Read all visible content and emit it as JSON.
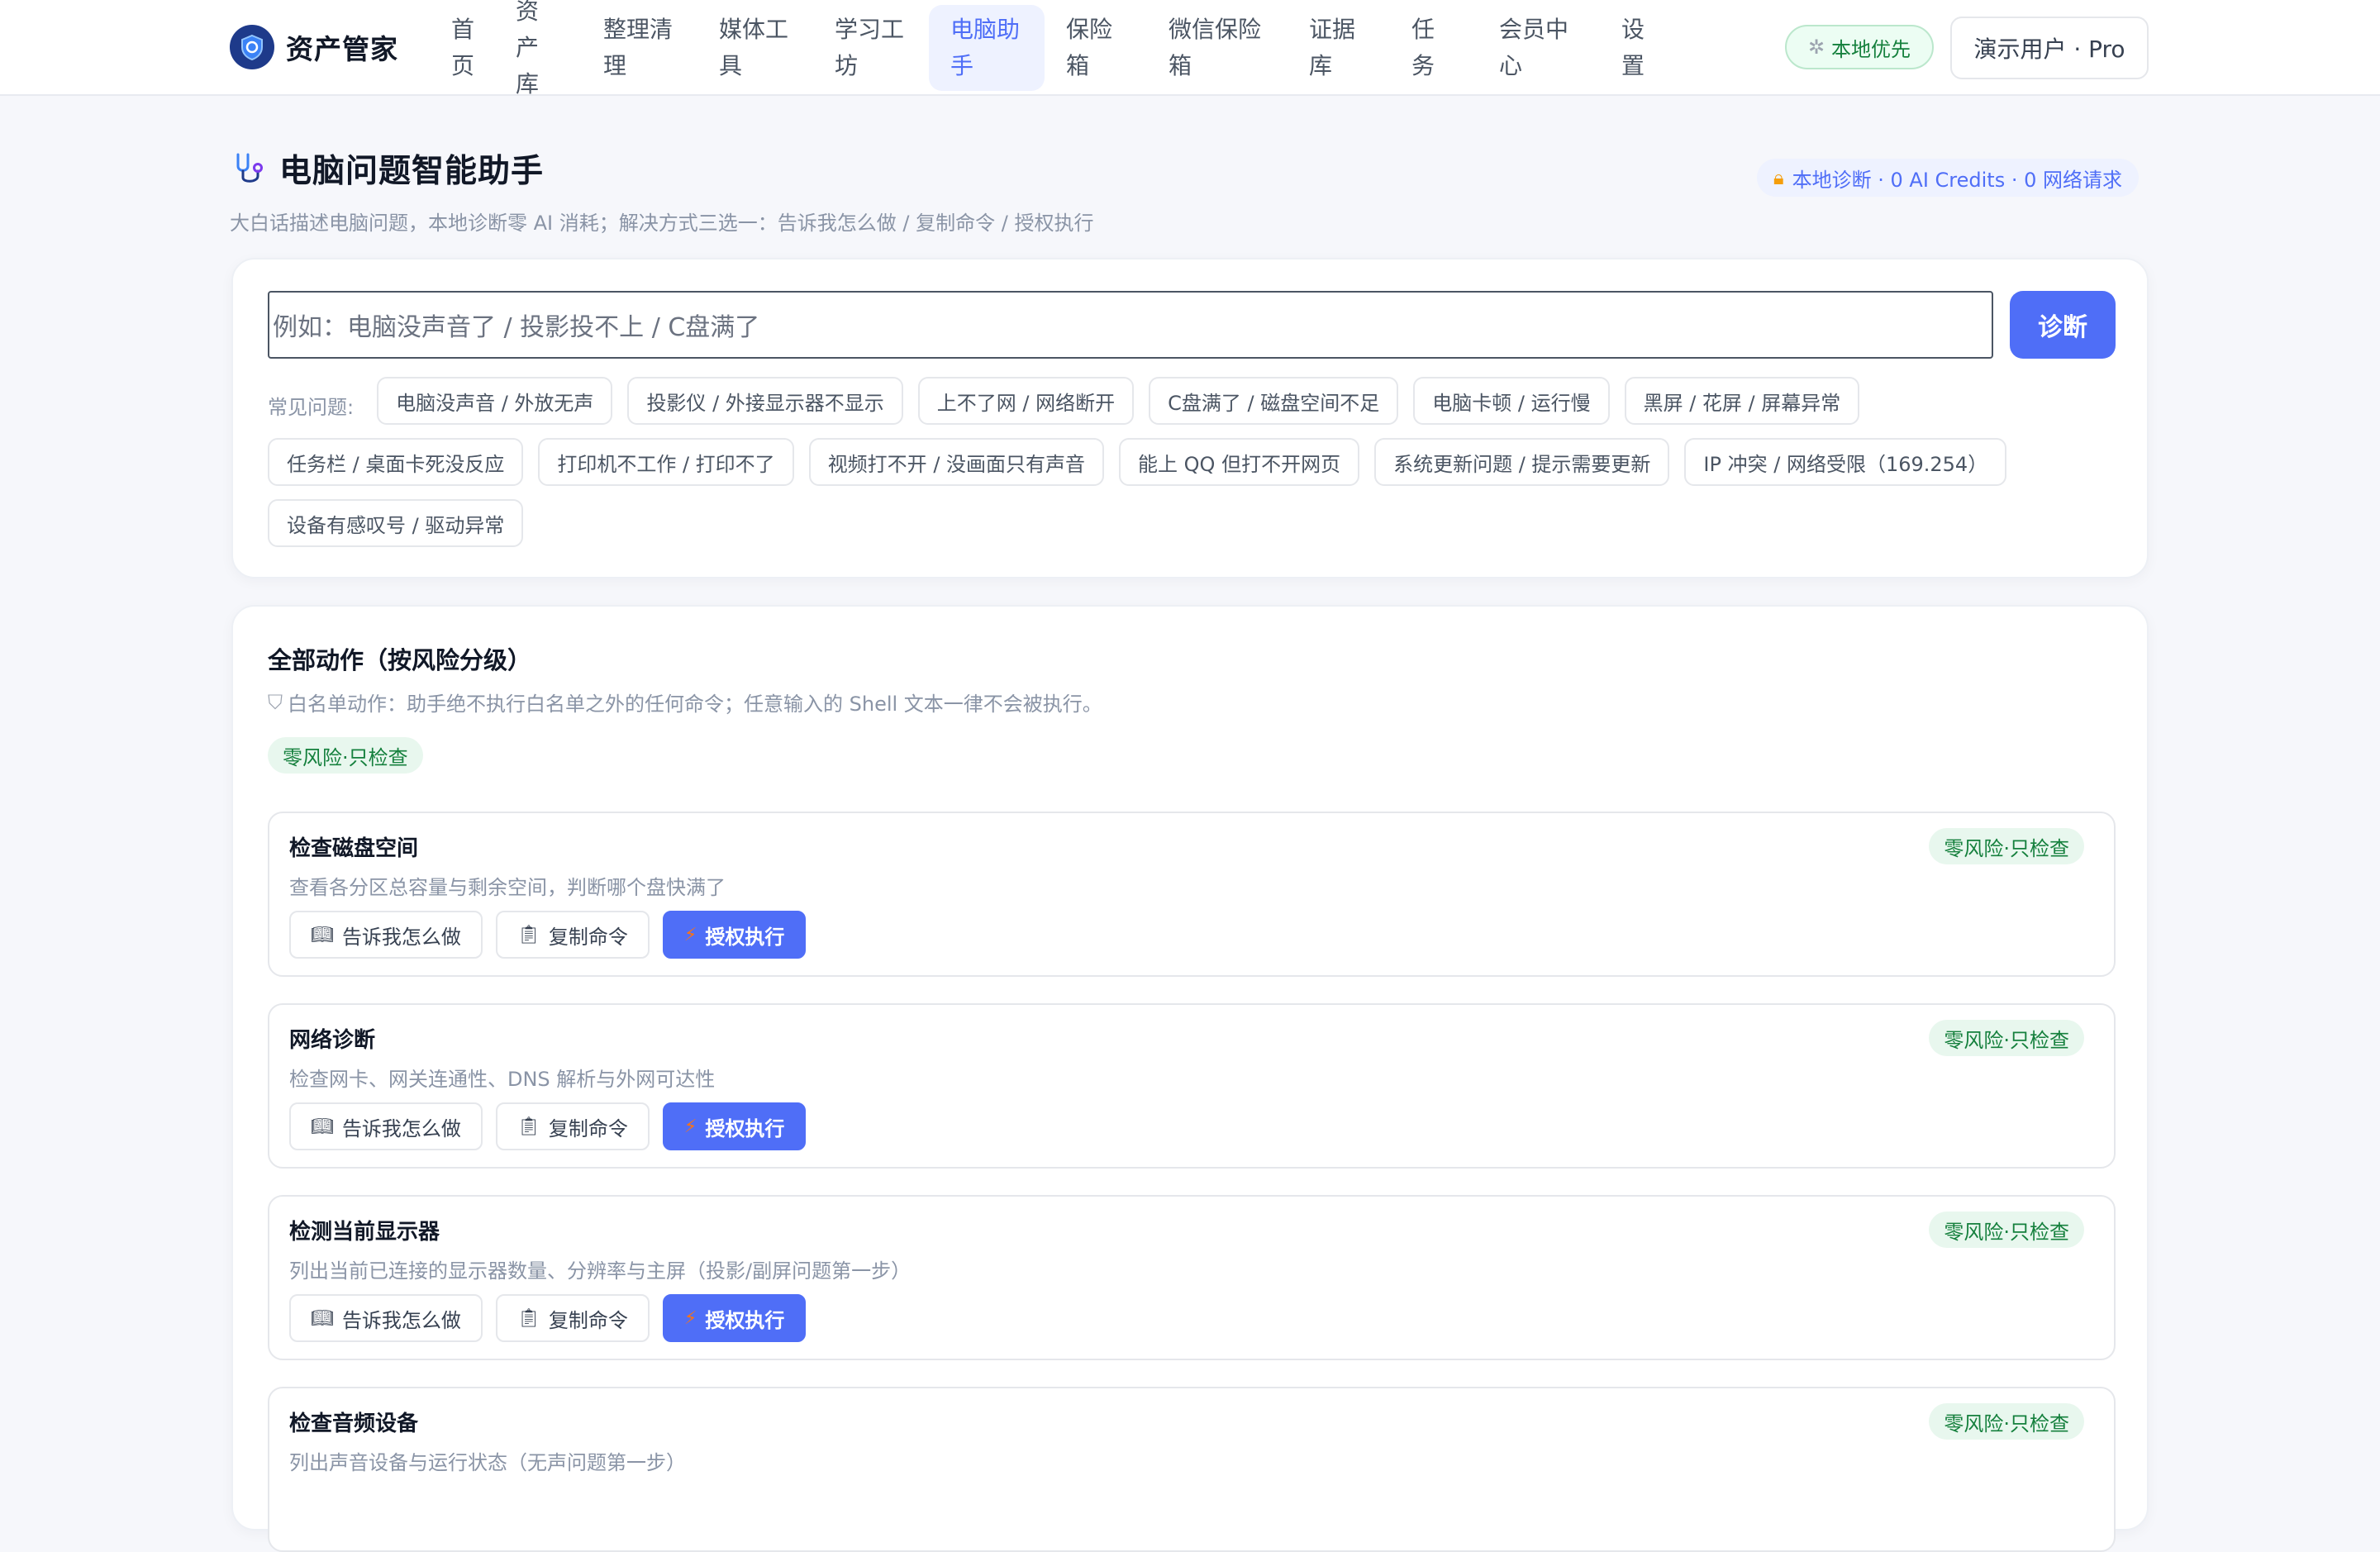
{
  "brand": {
    "name": "资产管家"
  },
  "nav": [
    {
      "label": "首页"
    },
    {
      "label": "资产库"
    },
    {
      "label": "整理清理"
    },
    {
      "label": "媒体工具"
    },
    {
      "label": "学习工坊"
    },
    {
      "label": "电脑助手",
      "active": true
    },
    {
      "label": "保险箱"
    },
    {
      "label": "微信保险箱"
    },
    {
      "label": "证据库"
    },
    {
      "label": "任务"
    },
    {
      "label": "会员中心"
    },
    {
      "label": "设置"
    }
  ],
  "header_right": {
    "local_pill": "本地优先",
    "user": "演示用户 · Pro"
  },
  "page": {
    "title": "电脑问题智能助手",
    "subtitle": "大白话描述电脑问题，本地诊断零 AI 消耗；解决方式三选一：告诉我怎么做 / 复制命令 / 授权执行",
    "stats": "本地诊断 · 0 AI Credits · 0 网络请求"
  },
  "search": {
    "placeholder": "例如：电脑没声音了 / 投影投不上 / C盘满了",
    "button": "诊断",
    "chips_label": "常见问题:",
    "chips": [
      "电脑没声音 / 外放无声",
      "投影仪 / 外接显示器不显示",
      "上不了网 / 网络断开",
      "C盘满了 / 磁盘空间不足",
      "电脑卡顿 / 运行慢",
      "黑屏 / 花屏 / 屏幕异常",
      "任务栏 / 桌面卡死没反应",
      "打印机不工作 / 打印不了",
      "视频打不开 / 没画面只有声音",
      "能上 QQ 但打不开网页",
      "系统更新问题 / 提示需要更新",
      "IP 冲突 / 网络受限（169.254）",
      "设备有感叹号 / 驱动异常"
    ]
  },
  "actions": {
    "title": "全部动作（按风险分级）",
    "note": "白名单动作：助手绝不执行白名单之外的任何命令；任意输入的 Shell 文本一律不会被执行。",
    "group_tag": "零风险·只检查",
    "btn_tell": "告诉我怎么做",
    "btn_copy": "复制命令",
    "btn_exec": "授权执行",
    "items": [
      {
        "title": "检查磁盘空间",
        "desc": "查看各分区总容量与剩余空间，判断哪个盘快满了",
        "tag": "零风险·只检查"
      },
      {
        "title": "网络诊断",
        "desc": "检查网卡、网关连通性、DNS 解析与外网可达性",
        "tag": "零风险·只检查"
      },
      {
        "title": "检测当前显示器",
        "desc": "列出当前已连接的显示器数量、分辨率与主屏（投影/副屏问题第一步）",
        "tag": "零风险·只检查"
      },
      {
        "title": "检查音频设备",
        "desc": "列出声音设备与运行状态（无声问题第一步）",
        "tag": "零风险·只检查"
      }
    ]
  },
  "colors": {
    "accent": "#4f6ef7",
    "risk_green": "#15803d",
    "risk_bg": "#e8f7ee"
  }
}
